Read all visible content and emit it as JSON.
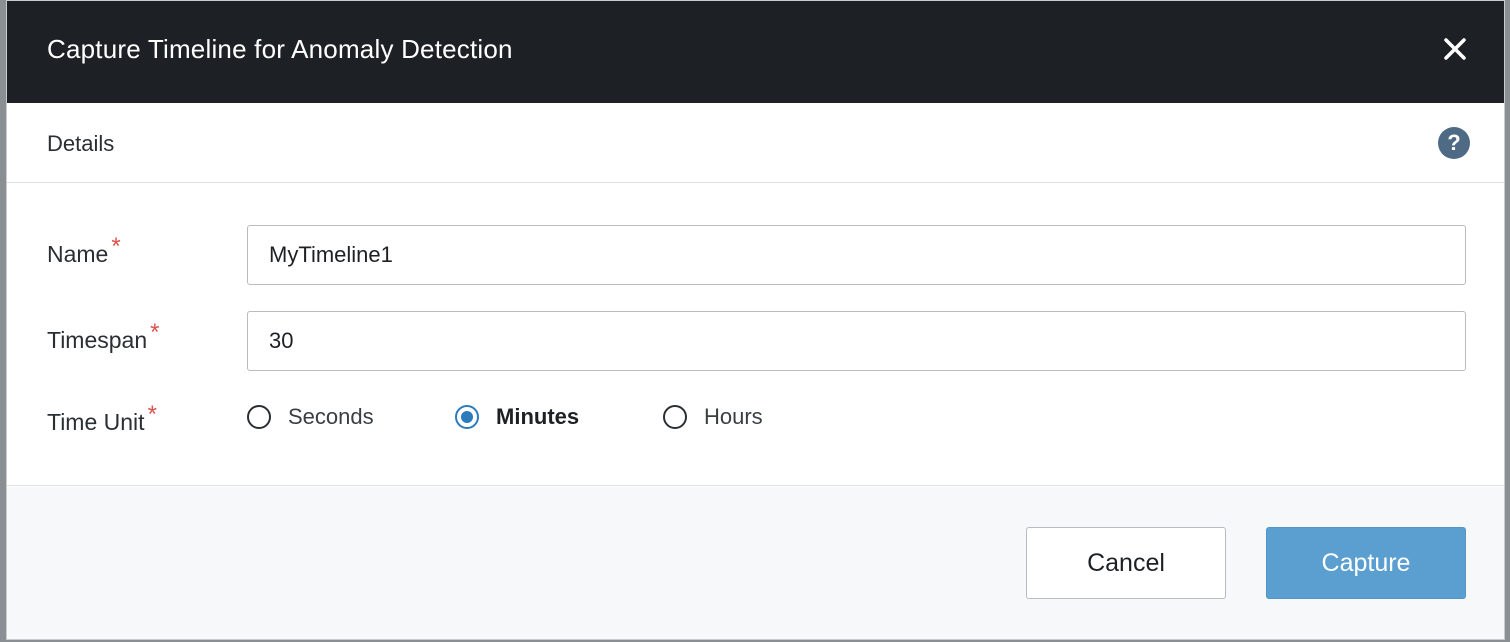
{
  "dialog": {
    "title": "Capture Timeline for Anomaly Detection",
    "close_icon": "close-icon"
  },
  "section": {
    "title": "Details",
    "help_icon": "help-icon",
    "help_glyph": "?"
  },
  "form": {
    "required_marker": "*",
    "name": {
      "label": "Name",
      "value": "MyTimeline1"
    },
    "timespan": {
      "label": "Timespan",
      "value": "30"
    },
    "time_unit": {
      "label": "Time Unit",
      "options": [
        "Seconds",
        "Minutes",
        "Hours"
      ],
      "selected": "Minutes"
    }
  },
  "footer": {
    "cancel_label": "Cancel",
    "capture_label": "Capture"
  },
  "colors": {
    "header_bg": "#1d2125",
    "accent": "#2b7bbd",
    "primary_button": "#5b9fd0",
    "required": "#d9534f",
    "help_icon_bg": "#4e6a85"
  }
}
